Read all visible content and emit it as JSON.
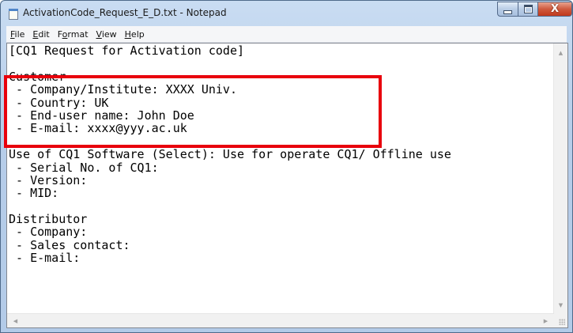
{
  "window": {
    "title": "ActivationCode_Request_E_D.txt - Notepad",
    "icons": {
      "app": "notepad-icon",
      "minimize": "minimize-icon",
      "maximize": "maximize-icon",
      "close": "close-icon"
    },
    "close_glyph": "X"
  },
  "menu": {
    "items": [
      {
        "label_ul": "F",
        "label_rest": "ile"
      },
      {
        "label_ul": "E",
        "label_rest": "dit"
      },
      {
        "label_pre": "F",
        "label_ul": "o",
        "label_rest": "rmat"
      },
      {
        "label_ul": "V",
        "label_rest": "iew"
      },
      {
        "label_ul": "H",
        "label_rest": "elp"
      }
    ]
  },
  "document": {
    "lines": [
      "[CQ1 Request for Activation code]",
      "",
      "Customer",
      " - Company/Institute: XXXX Univ.",
      " - Country: UK",
      " - End-user name: John Doe",
      " - E-mail: xxxx@yyy.ac.uk",
      "",
      "Use of CQ1 Software (Select): Use for operate CQ1/ Offline use",
      " - Serial No. of CQ1:",
      " - Version:",
      " - MID:",
      "",
      "Distributor",
      " - Company:",
      " - Sales contact:",
      " - E-mail:"
    ]
  },
  "annotation": {
    "highlight_color": "#e8000c"
  },
  "scrollbar": {
    "up_arrow": "▲",
    "down_arrow": "▼",
    "left_arrow": "◀",
    "right_arrow": "▶"
  }
}
